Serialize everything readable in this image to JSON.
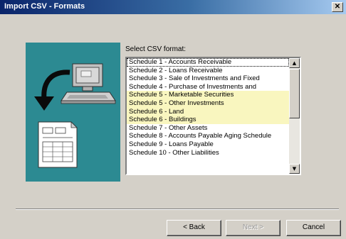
{
  "window": {
    "title": "Import CSV - Formats",
    "close_glyph": "✕"
  },
  "main": {
    "select_label": "Select CSV format:",
    "list_items": [
      {
        "label": "Schedule 1 - Accounts Receivable",
        "highlighted": false,
        "focused": true
      },
      {
        "label": "Schedule 2 - Loans Receivable",
        "highlighted": false
      },
      {
        "label": "Schedule 3 - Sale of Investments and Fixed",
        "highlighted": false
      },
      {
        "label": "Schedule 4 - Purchase of Investments and",
        "highlighted": false
      },
      {
        "label": "Schedule 5 - Marketable Securities",
        "highlighted": true
      },
      {
        "label": "Schedule 5 - Other Investments",
        "highlighted": true
      },
      {
        "label": "Schedule 6 - Land",
        "highlighted": true
      },
      {
        "label": "Schedule 6 - Buildings",
        "highlighted": true
      },
      {
        "label": "Schedule 7 - Other Assets",
        "highlighted": false
      },
      {
        "label": "Schedule 8 - Accounts Payable Aging Schedule",
        "highlighted": false
      },
      {
        "label": "Schedule 9 - Loans Payable",
        "highlighted": false
      },
      {
        "label": "Schedule 10 - Other Liabilities",
        "highlighted": false
      }
    ],
    "scroll_up_icon": "triangle-up",
    "scroll_down_icon": "triangle-down"
  },
  "buttons": {
    "back": "< Back",
    "next": "Next >",
    "cancel": "Cancel"
  },
  "colors": {
    "title_bar": "#0a246a",
    "illustration_bg": "#2c8a92",
    "highlight_row": "#f9f6bf",
    "dialog_bg": "#d4d0c8"
  }
}
